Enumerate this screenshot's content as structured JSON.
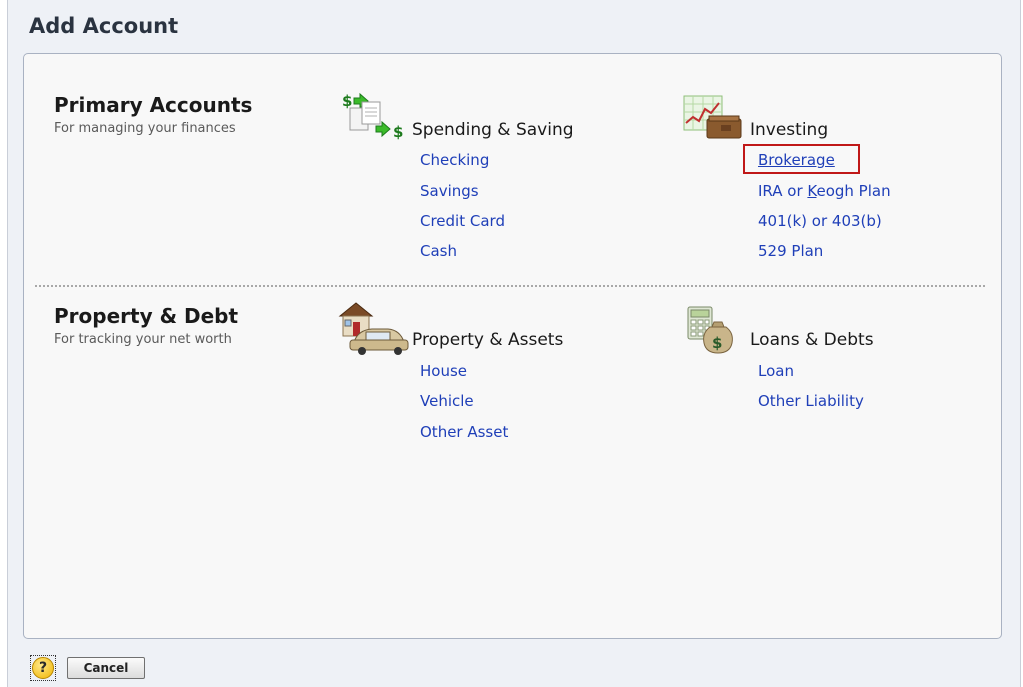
{
  "window": {
    "title": "Add Account"
  },
  "sections": [
    {
      "title": "Primary Accounts",
      "subtitle": "For managing your finances",
      "categories": [
        {
          "title": "Spending & Saving",
          "icon": "money-transfer-icon",
          "links": [
            "Checking",
            "Savings",
            "Credit Card",
            "Cash"
          ]
        },
        {
          "title": "Investing",
          "icon": "investment-chart-icon",
          "links": [
            "Brokerage",
            "IRA or Keogh Plan",
            "401(k) or 403(b)",
            "529 Plan"
          ]
        }
      ]
    },
    {
      "title": "Property & Debt",
      "subtitle": "For tracking your net worth",
      "categories": [
        {
          "title": "Property & Assets",
          "icon": "house-car-icon",
          "links": [
            "House",
            "Vehicle",
            "Other Asset"
          ]
        },
        {
          "title": "Loans & Debts",
          "icon": "calculator-money-bag-icon",
          "links": [
            "Loan",
            "Other Liability"
          ]
        }
      ]
    }
  ],
  "ira_parts": {
    "before": "IRA or ",
    "underlined": "K",
    "after": "eogh Plan"
  },
  "footer": {
    "help_label": "?",
    "cancel_label": "Cancel"
  },
  "colors": {
    "link": "#1f3fb8",
    "highlight": "#c01818",
    "panel_border": "#a9b2c2"
  }
}
